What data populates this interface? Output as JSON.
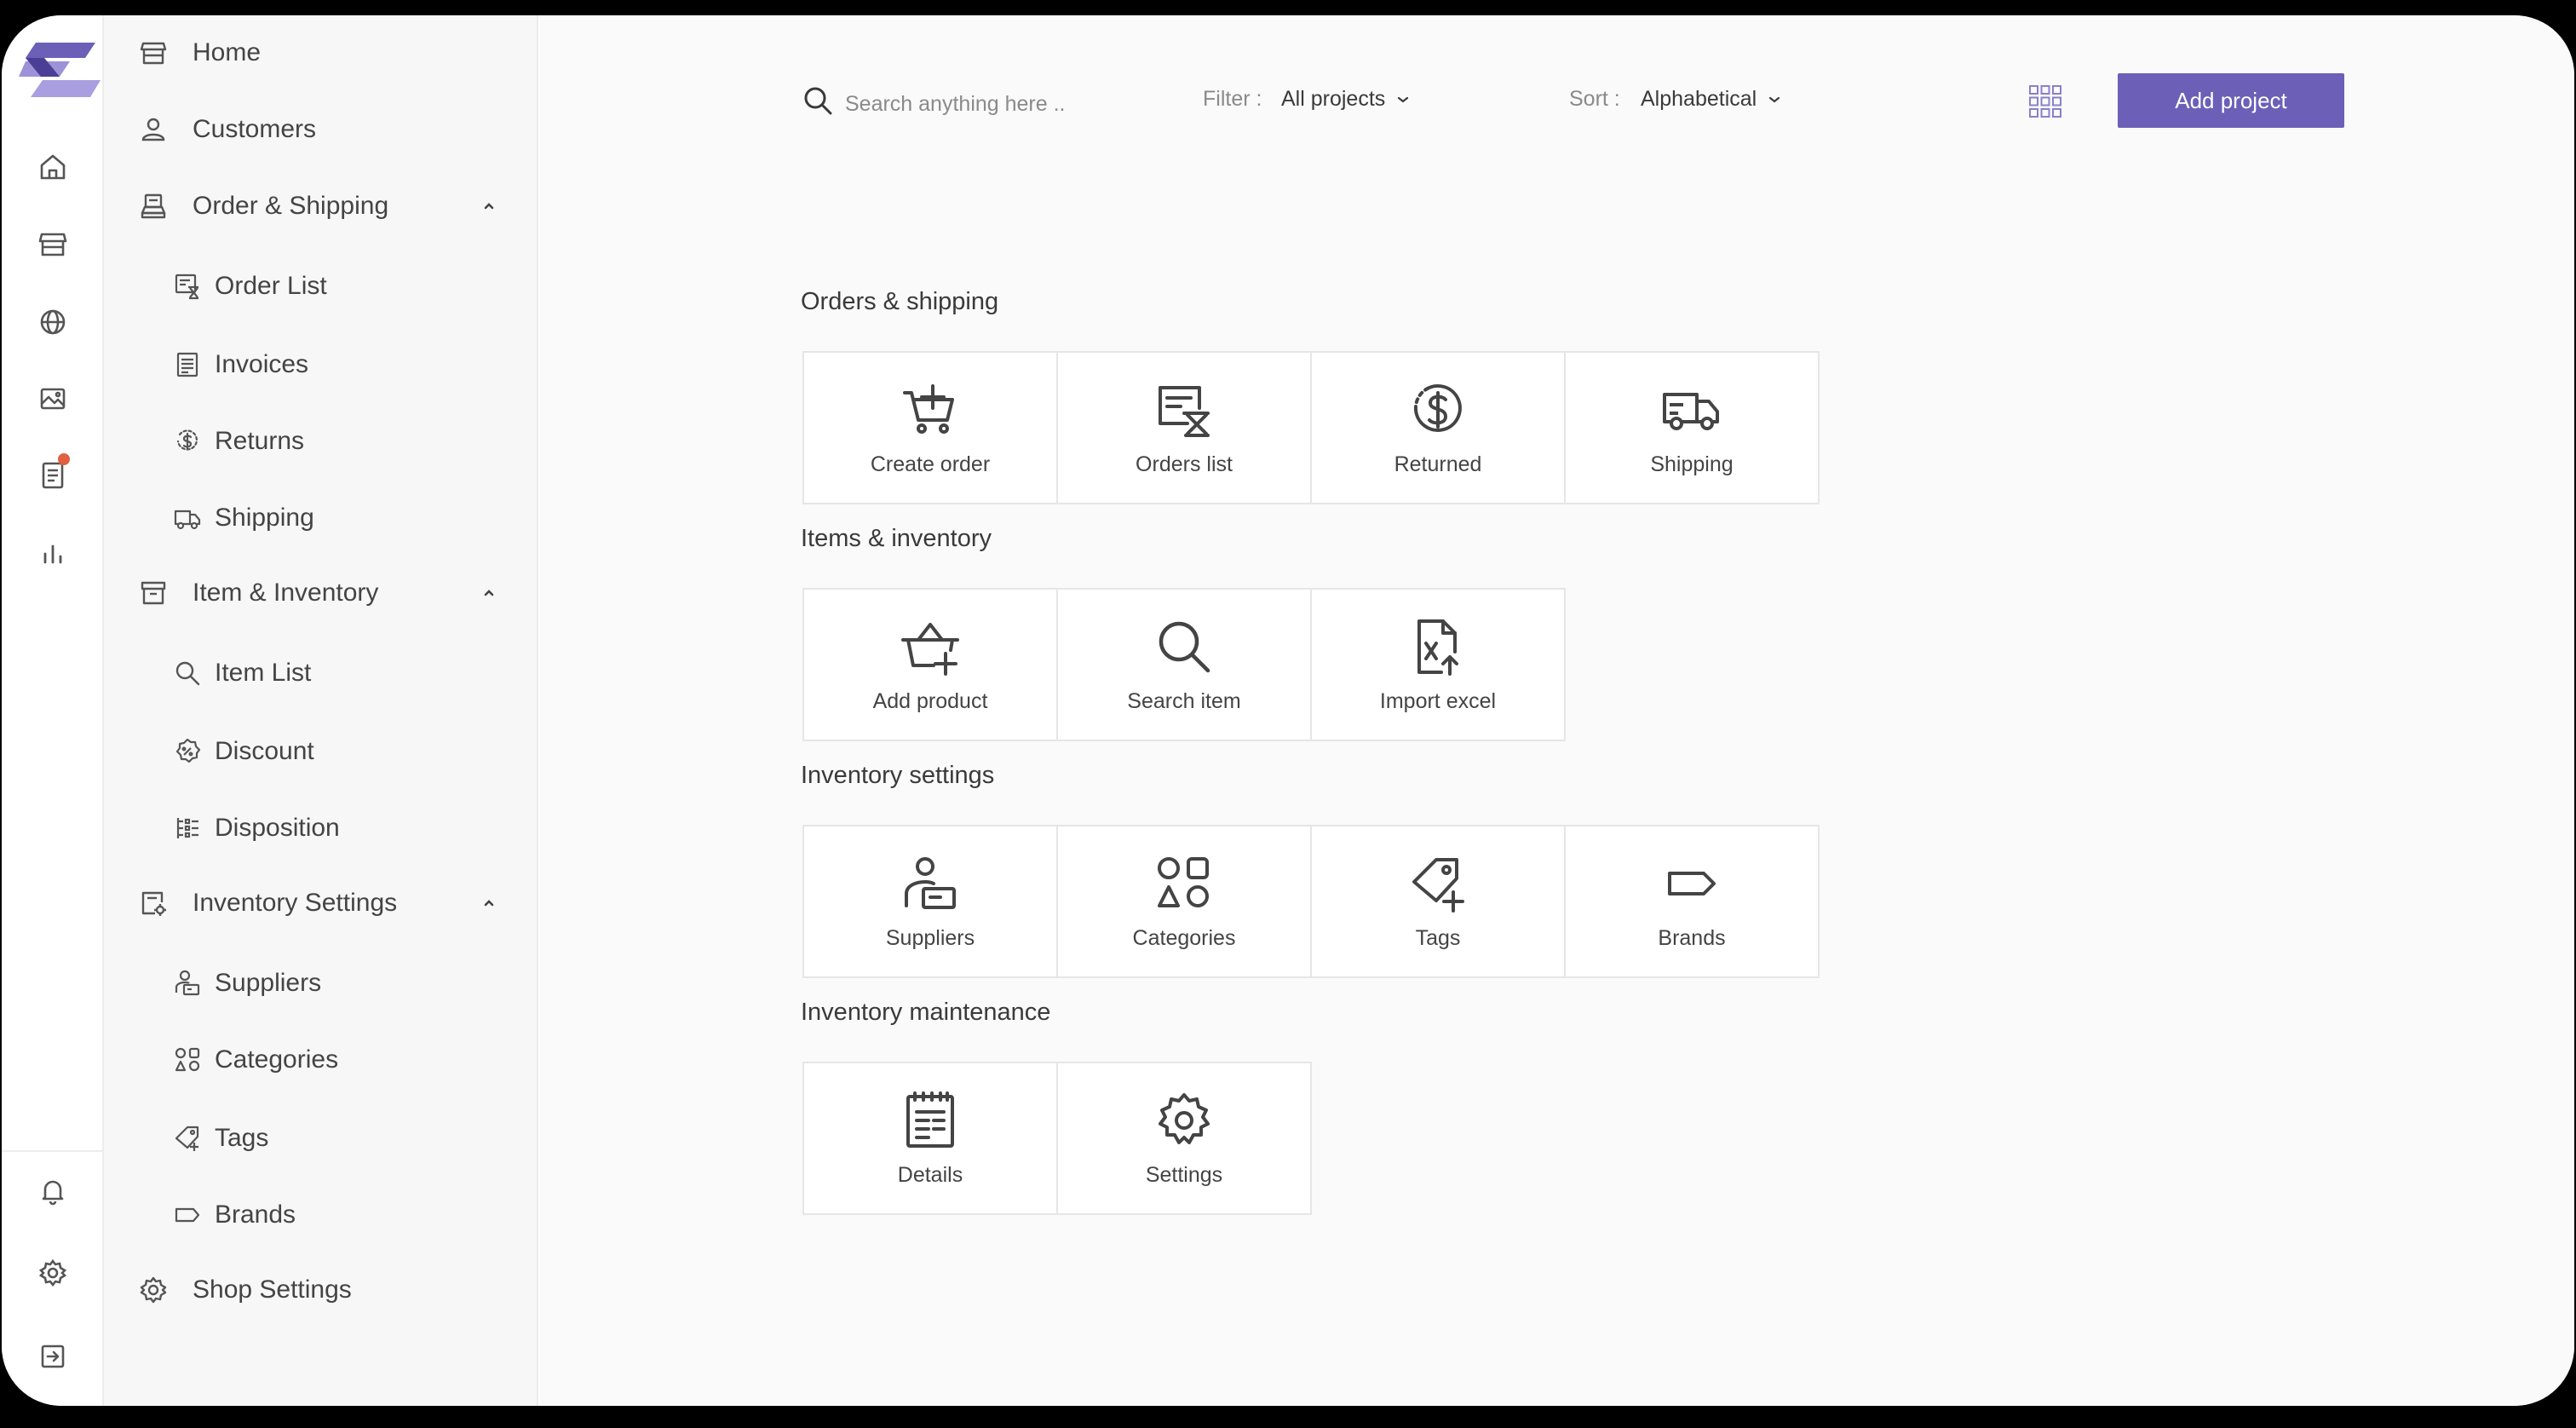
{
  "rail": {
    "icons": [
      "home-icon",
      "store-icon",
      "globe-icon",
      "gallery-icon",
      "document-icon",
      "chart-icon",
      "bell-icon",
      "gear-icon",
      "logout-icon"
    ],
    "notification_color": "#e0603f"
  },
  "sidebar": {
    "items": [
      {
        "label": "Home",
        "icon": "store-icon"
      },
      {
        "label": "Customers",
        "icon": "person-icon"
      },
      {
        "label": "Order & Shipping",
        "icon": "register-icon",
        "expanded": true
      },
      {
        "label": "Order List",
        "icon": "order-list-icon"
      },
      {
        "label": "Invoices",
        "icon": "invoice-icon"
      },
      {
        "label": "Returns",
        "icon": "returns-icon"
      },
      {
        "label": "Shipping",
        "icon": "truck-icon"
      },
      {
        "label": "Item & Inventory",
        "icon": "archive-icon",
        "expanded": true
      },
      {
        "label": "Item List",
        "icon": "search-icon"
      },
      {
        "label": "Discount",
        "icon": "discount-icon"
      },
      {
        "label": "Disposition",
        "icon": "disposition-icon"
      },
      {
        "label": "Inventory Settings",
        "icon": "inventory-settings-icon",
        "expanded": true
      },
      {
        "label": "Suppliers",
        "icon": "supplier-icon"
      },
      {
        "label": "Categories",
        "icon": "categories-icon"
      },
      {
        "label": "Tags",
        "icon": "tag-icon"
      },
      {
        "label": "Brands",
        "icon": "brand-icon"
      },
      {
        "label": "Shop Settings",
        "icon": "gear-icon"
      }
    ]
  },
  "toolbar": {
    "search_placeholder": "Search anything here ..",
    "filter_label": "Filter :",
    "filter_value": "All projects",
    "sort_label": "Sort :",
    "sort_value": "Alphabetical",
    "add_label": "Add project",
    "accent": "#6b5fb8"
  },
  "sections": [
    {
      "title": "Orders & shipping",
      "tiles": [
        {
          "label": "Create order",
          "icon": "cart-add-icon"
        },
        {
          "label": "Orders list",
          "icon": "orders-list-icon"
        },
        {
          "label": "Returned",
          "icon": "dollar-return-icon"
        },
        {
          "label": "Shipping",
          "icon": "truck-icon"
        }
      ]
    },
    {
      "title": "Items & inventory",
      "tiles": [
        {
          "label": "Add product",
          "icon": "basket-add-icon"
        },
        {
          "label": "Search item",
          "icon": "search-icon"
        },
        {
          "label": "Import excel",
          "icon": "excel-import-icon"
        }
      ]
    },
    {
      "title": "Inventory settings",
      "tiles": [
        {
          "label": "Suppliers",
          "icon": "supplier-icon"
        },
        {
          "label": "Categories",
          "icon": "categories-icon"
        },
        {
          "label": "Tags",
          "icon": "tag-add-icon"
        },
        {
          "label": "Brands",
          "icon": "brand-icon"
        }
      ]
    },
    {
      "title": "Inventory maintenance",
      "tiles": [
        {
          "label": "Details",
          "icon": "details-icon"
        },
        {
          "label": "Settings",
          "icon": "gear-icon"
        }
      ]
    }
  ]
}
